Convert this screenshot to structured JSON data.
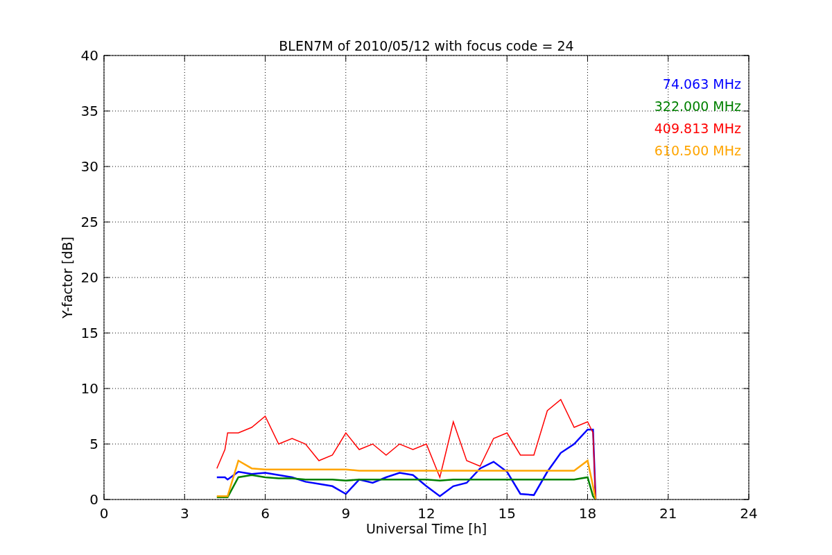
{
  "chart_data": {
    "type": "line",
    "title": "BLEN7M of 2010/05/12 with focus code = 24",
    "xlabel": "Universal Time [h]",
    "ylabel": "Y-factor [dB]",
    "xlim": [
      0,
      24
    ],
    "ylim": [
      0,
      40
    ],
    "xticks": [
      0,
      3,
      6,
      9,
      12,
      15,
      18,
      21,
      24
    ],
    "yticks": [
      0,
      5,
      10,
      15,
      20,
      25,
      30,
      35,
      40
    ],
    "grid": true,
    "x": [
      4.2,
      4.5,
      4.6,
      5,
      5.5,
      6,
      6.5,
      7,
      7.5,
      8,
      8.5,
      9,
      9.5,
      10,
      10.5,
      11,
      11.5,
      12,
      12.5,
      13,
      13.5,
      14,
      14.5,
      15,
      15.5,
      16,
      16.5,
      17,
      17.5,
      18,
      18.2,
      18.3
    ],
    "series": [
      {
        "name": "74.063 MHz",
        "color": "#0000ff",
        "values": [
          2,
          2,
          1.8,
          2.5,
          2.3,
          2.4,
          2.2,
          2.0,
          1.6,
          1.4,
          1.2,
          0.5,
          1.8,
          1.5,
          2,
          2.4,
          2.2,
          1.2,
          0.3,
          1.2,
          1.5,
          2.8,
          3.4,
          2.5,
          0.5,
          0.4,
          2.5,
          4.2,
          5,
          6.3,
          6.3,
          0
        ]
      },
      {
        "name": "322.000 MHz",
        "color": "#008000",
        "values": [
          0.2,
          0.2,
          0.2,
          2.0,
          2.2,
          2.0,
          1.9,
          1.9,
          1.8,
          1.8,
          1.8,
          1.7,
          1.8,
          1.8,
          1.8,
          1.8,
          1.8,
          1.8,
          1.7,
          1.8,
          1.8,
          1.8,
          1.8,
          1.8,
          1.8,
          1.8,
          1.8,
          1.8,
          1.8,
          2.0,
          0.3,
          0
        ]
      },
      {
        "name": "409.813 MHz",
        "color": "#ff0000",
        "values": [
          2.8,
          4.5,
          6,
          6,
          6.5,
          7.5,
          5,
          5.5,
          5,
          3.5,
          4,
          6,
          4.5,
          5,
          4,
          5,
          4.5,
          5,
          2,
          7,
          3.5,
          3,
          5.5,
          6,
          4,
          4,
          8,
          9,
          6.5,
          7,
          6,
          0
        ]
      },
      {
        "name": "610.500 MHz",
        "color": "#ffa500",
        "values": [
          0.3,
          0.3,
          0.3,
          3.5,
          2.8,
          2.7,
          2.7,
          2.7,
          2.7,
          2.7,
          2.7,
          2.7,
          2.6,
          2.6,
          2.6,
          2.6,
          2.6,
          2.6,
          2.6,
          2.6,
          2.6,
          2.6,
          2.6,
          2.6,
          2.6,
          2.6,
          2.6,
          2.6,
          2.6,
          3.5,
          1.2,
          0
        ]
      }
    ]
  }
}
